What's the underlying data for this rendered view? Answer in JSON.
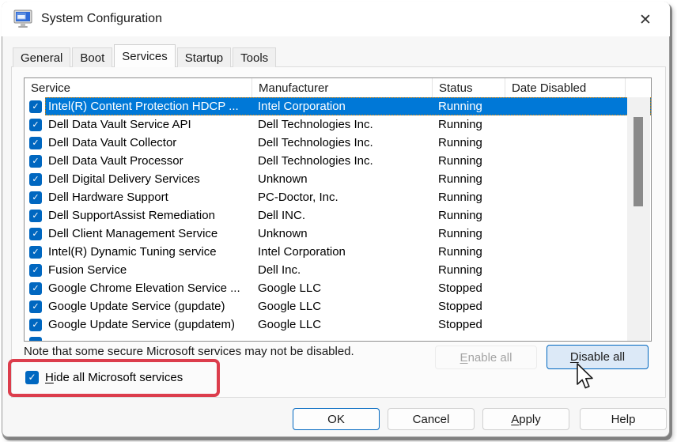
{
  "window": {
    "title": "System Configuration",
    "close_glyph": "✕"
  },
  "icons": {
    "check_glyph": "✓",
    "app_icon": "monitor-icon"
  },
  "tabs": [
    {
      "label": "General",
      "active": false
    },
    {
      "label": "Boot",
      "active": false
    },
    {
      "label": "Services",
      "active": true
    },
    {
      "label": "Startup",
      "active": false
    },
    {
      "label": "Tools",
      "active": false
    }
  ],
  "table": {
    "columns": [
      "Service",
      "Manufacturer",
      "Status",
      "Date Disabled"
    ],
    "rows": [
      {
        "checked": true,
        "service": "Intel(R) Content Protection HDCP ...",
        "manufacturer": "Intel Corporation",
        "status": "Running",
        "date_disabled": "",
        "selected": true
      },
      {
        "checked": true,
        "service": "Dell Data Vault Service API",
        "manufacturer": "Dell Technologies Inc.",
        "status": "Running",
        "date_disabled": "",
        "selected": false
      },
      {
        "checked": true,
        "service": "Dell Data Vault Collector",
        "manufacturer": "Dell Technologies Inc.",
        "status": "Running",
        "date_disabled": "",
        "selected": false
      },
      {
        "checked": true,
        "service": "Dell Data Vault Processor",
        "manufacturer": "Dell Technologies Inc.",
        "status": "Running",
        "date_disabled": "",
        "selected": false
      },
      {
        "checked": true,
        "service": "Dell Digital Delivery Services",
        "manufacturer": "Unknown",
        "status": "Running",
        "date_disabled": "",
        "selected": false
      },
      {
        "checked": true,
        "service": "Dell Hardware Support",
        "manufacturer": "PC-Doctor, Inc.",
        "status": "Running",
        "date_disabled": "",
        "selected": false
      },
      {
        "checked": true,
        "service": "Dell SupportAssist Remediation",
        "manufacturer": "Dell INC.",
        "status": "Running",
        "date_disabled": "",
        "selected": false
      },
      {
        "checked": true,
        "service": "Dell Client Management Service",
        "manufacturer": "Unknown",
        "status": "Running",
        "date_disabled": "",
        "selected": false
      },
      {
        "checked": true,
        "service": "Intel(R) Dynamic Tuning service",
        "manufacturer": "Intel Corporation",
        "status": "Running",
        "date_disabled": "",
        "selected": false
      },
      {
        "checked": true,
        "service": "Fusion Service",
        "manufacturer": "Dell Inc.",
        "status": "Running",
        "date_disabled": "",
        "selected": false
      },
      {
        "checked": true,
        "service": "Google Chrome Elevation Service ...",
        "manufacturer": "Google LLC",
        "status": "Stopped",
        "date_disabled": "",
        "selected": false
      },
      {
        "checked": true,
        "service": "Google Update Service (gupdate)",
        "manufacturer": "Google LLC",
        "status": "Stopped",
        "date_disabled": "",
        "selected": false
      },
      {
        "checked": true,
        "service": "Google Update Service (gupdatem)",
        "manufacturer": "Google LLC",
        "status": "Stopped",
        "date_disabled": "",
        "selected": false
      }
    ],
    "partial_row_visible": true
  },
  "note": "Note that some secure Microsoft services may not be disabled.",
  "hide_services_checkbox": {
    "key": "H",
    "post": "ide all Microsoft services",
    "checked": true
  },
  "buttons": {
    "enable_all": {
      "pre": "",
      "key": "E",
      "post": "nable all",
      "disabled": true
    },
    "disable_all": {
      "pre": "",
      "key": "D",
      "post": "isable all"
    },
    "ok": "OK",
    "cancel": "Cancel",
    "apply": {
      "pre": "",
      "key": "A",
      "post": "pply"
    },
    "help": "Help"
  },
  "colors": {
    "selection_blue": "#0078d7",
    "checkbox_blue": "#0067c0",
    "annotation_red": "#dc3d4c",
    "disable_all_bg": "#dce9f7",
    "focus_dotted": "#dd8500"
  }
}
